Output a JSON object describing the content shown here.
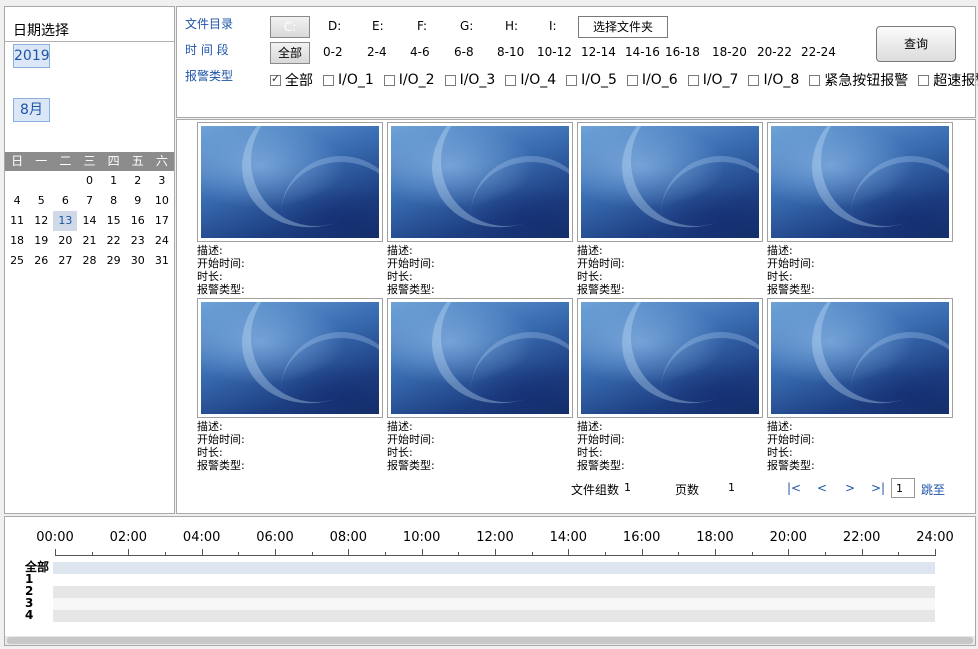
{
  "left": {
    "title": "日期选择",
    "year": "2019",
    "month": "8月",
    "weekdays": [
      "日",
      "一",
      "二",
      "三",
      "四",
      "五",
      "六"
    ],
    "weeks": [
      [
        "",
        "",
        "",
        "0",
        "1",
        "2",
        "3"
      ],
      [
        "4",
        "5",
        "6",
        "7",
        "8",
        "9",
        "10"
      ],
      [
        "11",
        "12",
        "13",
        "14",
        "15",
        "16",
        "17"
      ],
      [
        "18",
        "19",
        "20",
        "21",
        "22",
        "23",
        "24"
      ],
      [
        "25",
        "26",
        "27",
        "28",
        "29",
        "30",
        "31"
      ]
    ],
    "selected_day": "13"
  },
  "filters": {
    "dir_label": "文件目录",
    "time_label": "时 间 段",
    "alarm_label": "报警类型",
    "drives": [
      "C:",
      "D:",
      "E:",
      "F:",
      "G:",
      "H:",
      "I:"
    ],
    "select_folder": "选择文件夹",
    "query": "查询",
    "all_btn": "全部",
    "time_slots": [
      "0-2",
      "2-4",
      "4-6",
      "6-8",
      "8-10",
      "10-12",
      "12-14",
      "14-16",
      "16-18",
      "18-20",
      "20-22",
      "22-24"
    ],
    "alarm_types": [
      {
        "label": "全部",
        "checked": true
      },
      {
        "label": "I/O_1",
        "checked": false
      },
      {
        "label": "I/O_2",
        "checked": false
      },
      {
        "label": "I/O_3",
        "checked": false
      },
      {
        "label": "I/O_4",
        "checked": false
      },
      {
        "label": "I/O_5",
        "checked": false
      },
      {
        "label": "I/O_6",
        "checked": false
      },
      {
        "label": "I/O_7",
        "checked": false
      },
      {
        "label": "I/O_8",
        "checked": false
      },
      {
        "label": "紧急按钮报警",
        "checked": false
      },
      {
        "label": "超速报警",
        "checked": false
      }
    ]
  },
  "thumbs": {
    "meta_labels": [
      "描述:",
      "开始时间:",
      "时长:",
      "报警类型:"
    ]
  },
  "pager": {
    "group_label": "文件组数",
    "group_value": "1",
    "page_label": "页数",
    "page_value": "1",
    "first": "|<",
    "prev": "<",
    "next": ">",
    "last": ">|",
    "goto_value": "1",
    "goto": "跳至"
  },
  "timeline": {
    "hours": [
      "00:00",
      "02:00",
      "04:00",
      "06:00",
      "08:00",
      "10:00",
      "12:00",
      "14:00",
      "16:00",
      "18:00",
      "20:00",
      "22:00",
      "24:00"
    ],
    "rows": [
      "全部",
      "1",
      "2",
      "3",
      "4"
    ]
  }
}
